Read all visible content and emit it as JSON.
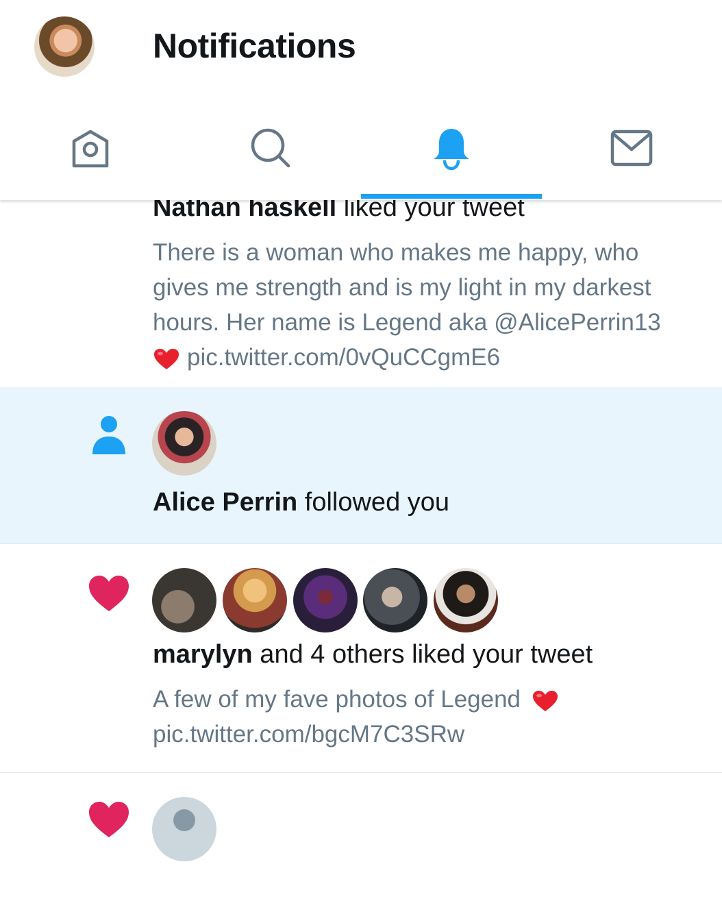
{
  "header": {
    "title": "Notifications",
    "avatar_icon": "profile-avatar"
  },
  "tabs": [
    {
      "name": "home",
      "icon": "home-icon",
      "active": false
    },
    {
      "name": "search",
      "icon": "search-icon",
      "active": false
    },
    {
      "name": "notifications",
      "icon": "bell-icon",
      "active": true
    },
    {
      "name": "messages",
      "icon": "mail-icon",
      "active": false
    }
  ],
  "colors": {
    "accent": "#1da1f2",
    "like": "#e0245e",
    "secondary_text": "#657786",
    "highlight_bg": "#e8f5fd"
  },
  "notifications": [
    {
      "type": "like",
      "actor": "Nathan haskell",
      "action": " liked your tweet",
      "tweet_lines": [
        "There is a woman who makes me happy, who",
        "gives me strength and is my light in my darkest",
        "hours. Her name is Legend aka @AlicePerrin13",
        "pic.twitter.com/0vQuCCgmE6"
      ]
    },
    {
      "type": "follow",
      "icon": "person-icon",
      "actor": "Alice Perrin",
      "action": " followed you"
    },
    {
      "type": "like",
      "icon": "heart-icon",
      "actor": "marylyn",
      "action": " and 4 others liked your tweet",
      "tweet_lines": [
        "A few of my fave photos of Legend",
        "pic.twitter.com/bgcM7C3SRw"
      ]
    },
    {
      "type": "like",
      "icon": "heart-icon"
    }
  ]
}
